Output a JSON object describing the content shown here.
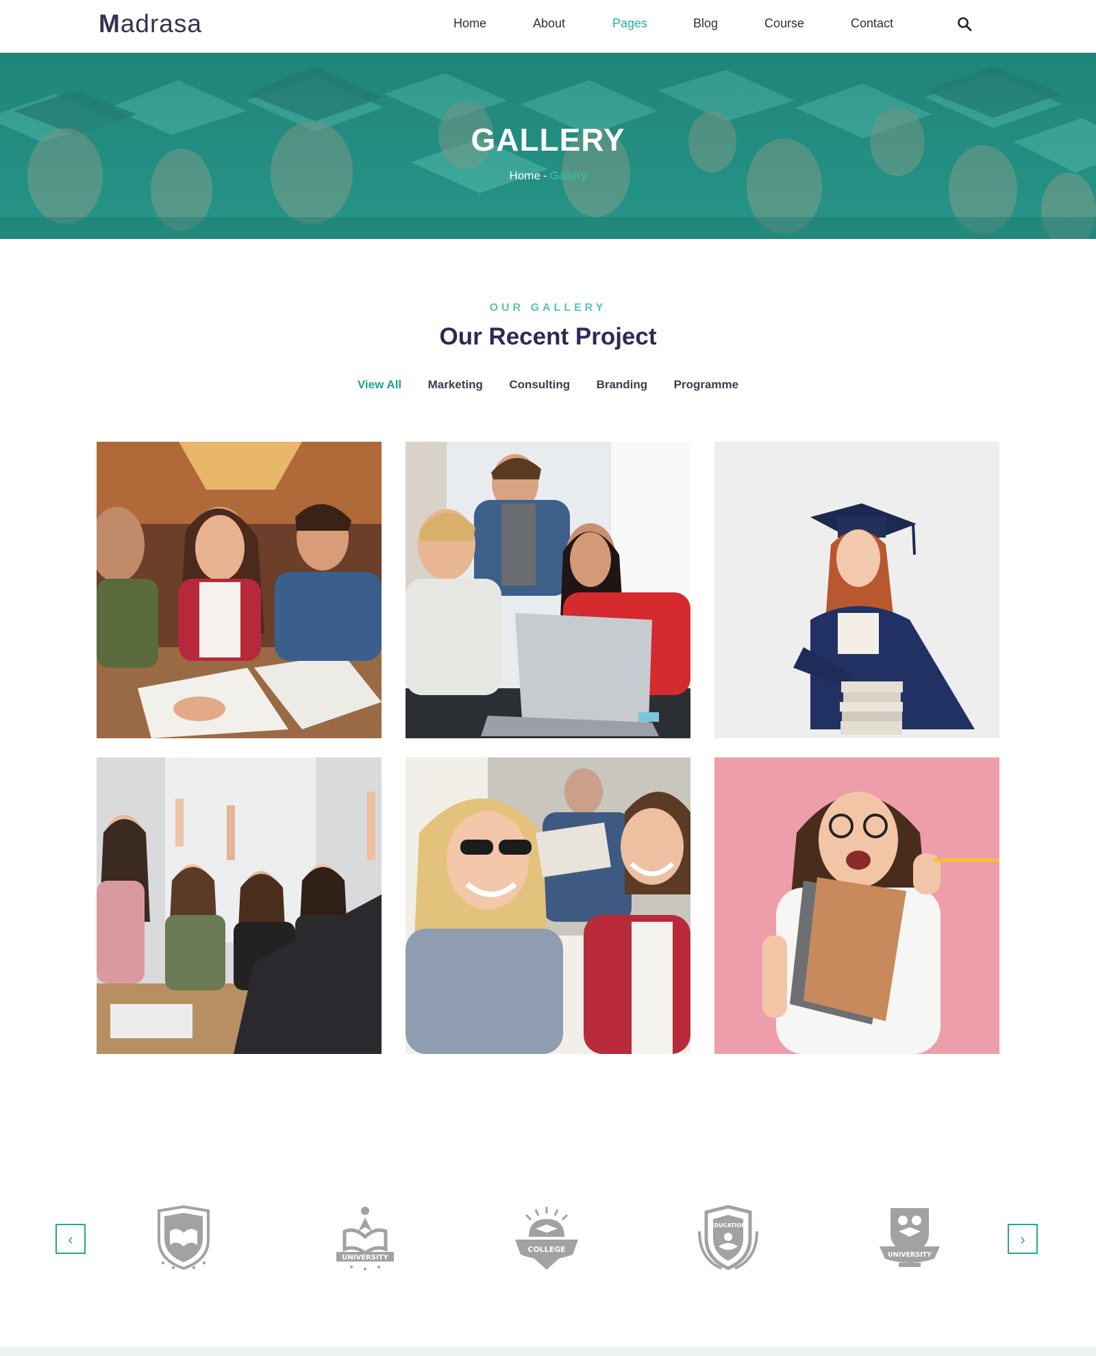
{
  "header": {
    "logo_initial": "M",
    "logo_rest": "adrasa",
    "nav": [
      {
        "label": "Home",
        "active": false
      },
      {
        "label": "About",
        "active": false
      },
      {
        "label": "Pages",
        "active": true
      },
      {
        "label": "Blog",
        "active": false
      },
      {
        "label": "Course",
        "active": false
      },
      {
        "label": "Contact",
        "active": false
      }
    ],
    "search_icon": "search-icon"
  },
  "hero": {
    "title": "GALLERY",
    "breadcrumb": {
      "home": "Home",
      "separator": "-",
      "current": "Gallery"
    }
  },
  "section": {
    "eyebrow": "OUR GALLERY",
    "title": "Our Recent Project",
    "filters": [
      {
        "label": "View All",
        "active": true
      },
      {
        "label": "Marketing",
        "active": false
      },
      {
        "label": "Consulting",
        "active": false
      },
      {
        "label": "Branding",
        "active": false
      },
      {
        "label": "Programme",
        "active": false
      }
    ]
  },
  "gallery": [
    {
      "name": "students-studying-photo"
    },
    {
      "name": "students-laptop-photo"
    },
    {
      "name": "graduate-girl-books-photo"
    },
    {
      "name": "classroom-hands-raised-photo"
    },
    {
      "name": "friends-laughing-photo"
    },
    {
      "name": "girl-notebooks-pink-photo"
    }
  ],
  "partners": {
    "prev_icon": "chevron-left-icon",
    "next_icon": "chevron-right-icon",
    "logos": [
      {
        "name": "open-book-shield-logo"
      },
      {
        "name": "university-logo",
        "text": "UNIVERSITY"
      },
      {
        "name": "college-logo",
        "text": "COLLEGE"
      },
      {
        "name": "education-logo",
        "text": "EDUCATION"
      },
      {
        "name": "university-shield-logo",
        "text": "UNIVERSITY"
      }
    ]
  },
  "colors": {
    "accent": "#20b2a5",
    "heading": "#2d2b55",
    "text": "#2f2d3a",
    "logo_gray": "#9d9d9d"
  }
}
